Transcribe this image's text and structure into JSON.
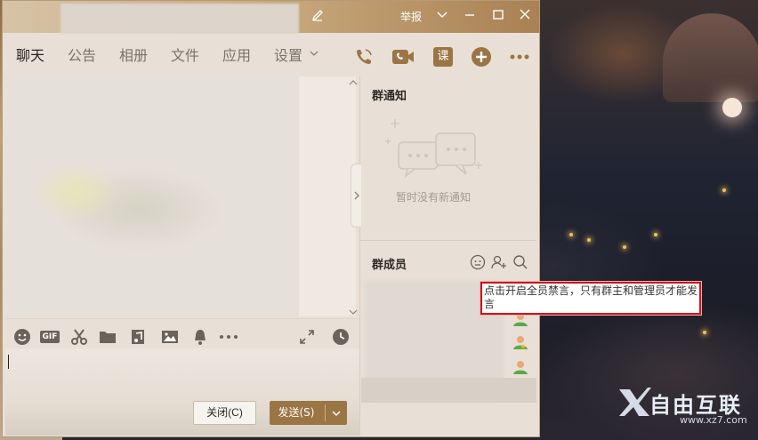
{
  "window": {
    "report_label": "举报"
  },
  "tabs": [
    {
      "label": "聊天",
      "active": true
    },
    {
      "label": "公告"
    },
    {
      "label": "相册"
    },
    {
      "label": "文件"
    },
    {
      "label": "应用"
    },
    {
      "label": "设置"
    }
  ],
  "header_actions": {
    "course_label": "课"
  },
  "toolbar": {
    "gif_label": "GIF"
  },
  "buttons": {
    "close_label": "关闭(C)",
    "send_label": "发送(S)"
  },
  "notice": {
    "title": "群通知",
    "empty_text": "暂时没有新通知"
  },
  "members": {
    "title": "群成员"
  },
  "tooltip": {
    "text": "点击开启全员禁言，只有群主和管理员才能发言"
  },
  "watermark": {
    "text": "自由互联",
    "url": "www.xz7.com"
  },
  "colors": {
    "accent": "#9b7544",
    "titlebar": "#c8a97e",
    "highlight_border": "#d0121a"
  }
}
